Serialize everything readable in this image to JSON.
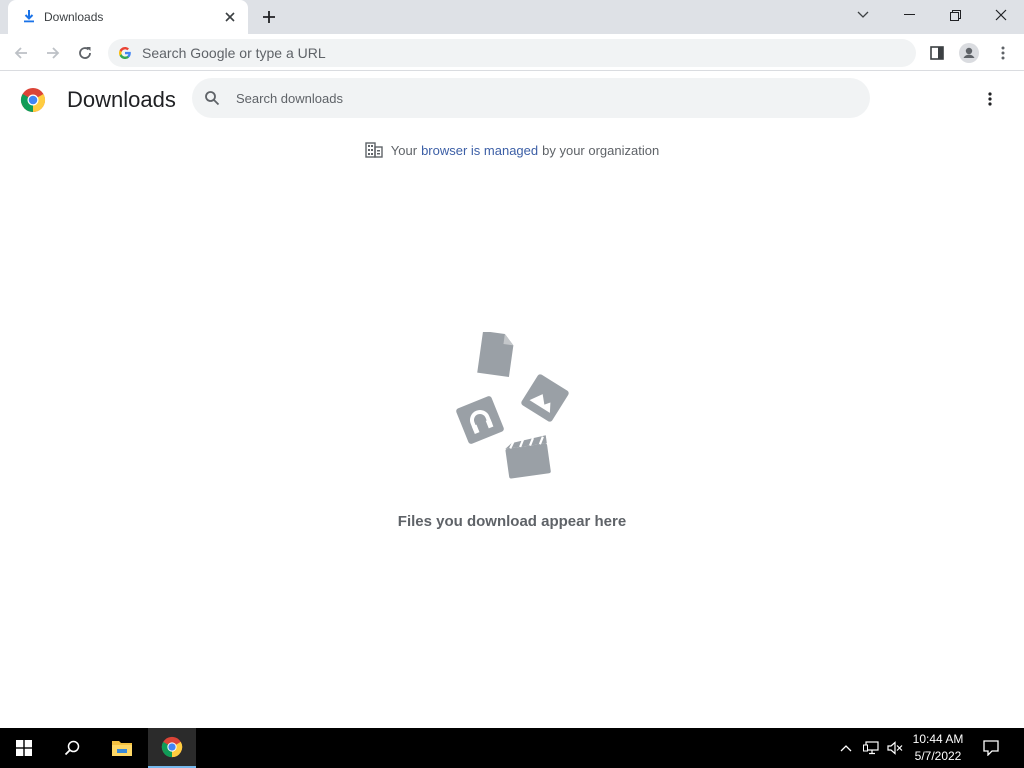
{
  "tab": {
    "title": "Downloads",
    "icon": "download-icon"
  },
  "omnibox": {
    "placeholder": "Search Google or type a URL"
  },
  "page": {
    "title": "Downloads",
    "search_placeholder": "Search downloads"
  },
  "managed": {
    "prefix": "Your",
    "link": "browser is managed",
    "suffix": "by your organization"
  },
  "empty_state": {
    "message": "Files you download appear here"
  },
  "taskbar": {
    "time": "10:44 AM",
    "date": "5/7/2022"
  },
  "colors": {
    "accent": "#1a73e8",
    "link": "#3c5fa6",
    "illustration": "#9aa0a6"
  }
}
